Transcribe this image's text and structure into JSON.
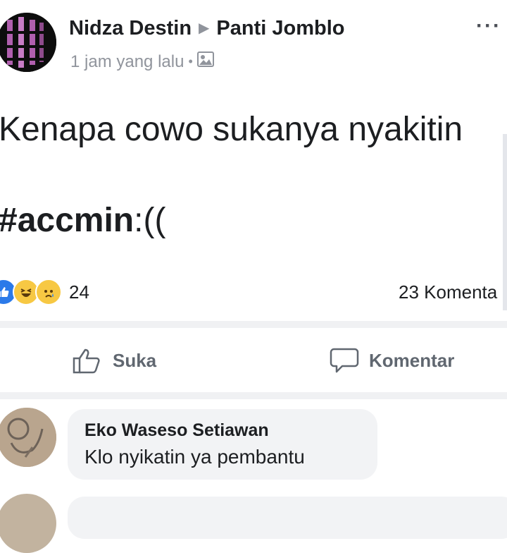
{
  "post": {
    "author": "Nidza Destin",
    "group": "Panti Jomblo",
    "time": "1 jam yang lalu",
    "text": "Kenapa cowo sukanya nyakitin",
    "hashtag": "#accmin",
    "hashtag_suffix": ":((",
    "reaction_count": "24",
    "comment_count": "23 Komenta"
  },
  "actions": {
    "like_label": "Suka",
    "comment_label": "Komentar"
  },
  "comment": {
    "name": "Eko Waseso Setiawan",
    "text": "Klo nyikatin ya pembantu"
  },
  "colors": {
    "like_blue": "#2b7ae9",
    "emoji_yellow": "#f7c843",
    "meta_gray": "#90949c",
    "action_gray": "#606770"
  }
}
